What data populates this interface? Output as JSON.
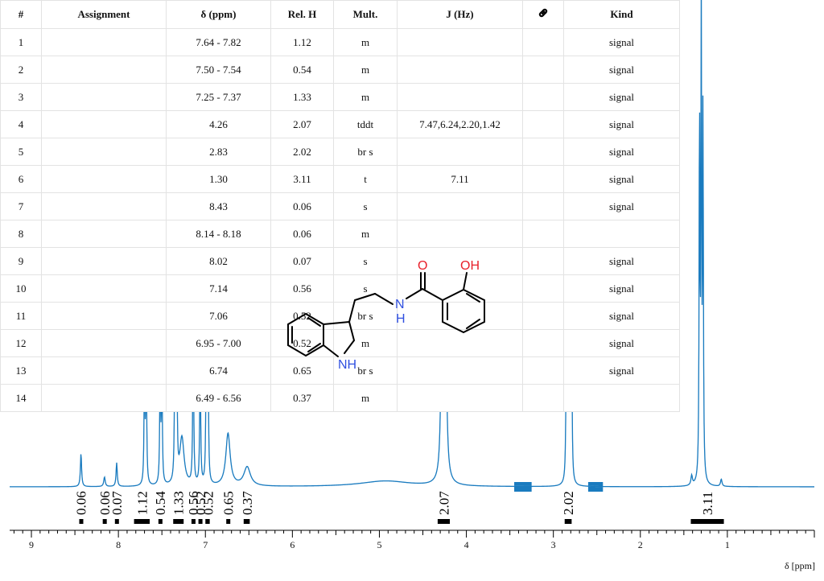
{
  "table": {
    "columns": [
      "#",
      "Assignment",
      "δ (ppm)",
      "Rel. H",
      "Mult.",
      "J (Hz)",
      "link-icon",
      "Kind"
    ],
    "rows": [
      [
        "1",
        "",
        "7.64 - 7.82",
        "1.12",
        "m",
        "",
        "",
        "signal"
      ],
      [
        "2",
        "",
        "7.50 - 7.54",
        "0.54",
        "m",
        "",
        "",
        "signal"
      ],
      [
        "3",
        "",
        "7.25 - 7.37",
        "1.33",
        "m",
        "",
        "",
        "signal"
      ],
      [
        "4",
        "",
        "4.26",
        "2.07",
        "tddt",
        "7.47,6.24,2.20,1.42",
        "",
        "signal"
      ],
      [
        "5",
        "",
        "2.83",
        "2.02",
        "br s",
        "",
        "",
        "signal"
      ],
      [
        "6",
        "",
        "1.30",
        "3.11",
        "t",
        "7.11",
        "",
        "signal"
      ],
      [
        "7",
        "",
        "8.43",
        "0.06",
        "s",
        "",
        "",
        "signal"
      ],
      [
        "8",
        "",
        "8.14 - 8.18",
        "0.06",
        "m",
        "",
        "",
        ""
      ],
      [
        "9",
        "",
        "8.02",
        "0.07",
        "s",
        "",
        "",
        "signal"
      ],
      [
        "10",
        "",
        "7.14",
        "0.56",
        "s",
        "",
        "",
        "signal"
      ],
      [
        "11",
        "",
        "7.06",
        "0.52",
        "br s",
        "",
        "",
        "signal"
      ],
      [
        "12",
        "",
        "6.95 - 7.00",
        "0.52",
        "m",
        "",
        "",
        "signal"
      ],
      [
        "13",
        "",
        "6.74",
        "0.65",
        "br s",
        "",
        "",
        "signal"
      ],
      [
        "14",
        "",
        "6.49 - 6.56",
        "0.37",
        "m",
        "",
        "",
        ""
      ]
    ]
  },
  "molecule": {
    "labels": {
      "o1": "O",
      "oh": "OH",
      "n": "N",
      "h": "H",
      "nh": "NH"
    },
    "colors": {
      "oxygen": "#e8202a",
      "nitrogen": "#3050e0",
      "bond": "#000000"
    }
  },
  "chart_data": {
    "type": "line",
    "xlabel": "δ [ppm]",
    "xlim": [
      9.25,
      0.0
    ],
    "x_ticks": [
      9,
      8,
      7,
      6,
      5,
      4,
      3,
      2,
      1
    ],
    "line_color": "#1a7bbf",
    "peaks": [
      {
        "x": 8.43,
        "h": 0.07,
        "w": 0.008
      },
      {
        "x": 8.16,
        "h": 0.02,
        "w": 0.01
      },
      {
        "x": 8.02,
        "h": 0.05,
        "w": 0.008
      },
      {
        "x": 7.7,
        "h": 0.25,
        "w": 0.006
      },
      {
        "x": 7.68,
        "h": 0.27,
        "w": 0.006
      },
      {
        "x": 7.52,
        "h": 0.25,
        "w": 0.006
      },
      {
        "x": 7.5,
        "h": 0.24,
        "w": 0.006
      },
      {
        "x": 7.35,
        "h": 0.34,
        "w": 0.006
      },
      {
        "x": 7.33,
        "h": 0.32,
        "w": 0.006
      },
      {
        "x": 7.27,
        "h": 0.1,
        "w": 0.03
      },
      {
        "x": 7.14,
        "h": 0.36,
        "w": 0.006
      },
      {
        "x": 7.06,
        "h": 0.29,
        "w": 0.006
      },
      {
        "x": 6.99,
        "h": 0.3,
        "w": 0.006
      },
      {
        "x": 6.97,
        "h": 0.32,
        "w": 0.006
      },
      {
        "x": 6.74,
        "h": 0.11,
        "w": 0.03
      },
      {
        "x": 6.52,
        "h": 0.04,
        "w": 0.045
      },
      {
        "x": 4.93,
        "h": 0.012,
        "w": 0.35
      },
      {
        "x": 4.28,
        "h": 0.4,
        "w": 0.012
      },
      {
        "x": 4.26,
        "h": 0.42,
        "w": 0.012
      },
      {
        "x": 4.24,
        "h": 0.4,
        "w": 0.012
      },
      {
        "x": 2.85,
        "h": 0.35,
        "w": 0.006
      },
      {
        "x": 2.83,
        "h": 0.34,
        "w": 0.006
      },
      {
        "x": 2.81,
        "h": 0.33,
        "w": 0.006
      },
      {
        "x": 2.79,
        "h": 0.32,
        "w": 0.006
      },
      {
        "x": 1.32,
        "h": 0.8,
        "w": 0.005
      },
      {
        "x": 1.3,
        "h": 1.0,
        "w": 0.005
      },
      {
        "x": 1.28,
        "h": 0.78,
        "w": 0.005
      },
      {
        "x": 1.41,
        "h": 0.02,
        "w": 0.01
      },
      {
        "x": 1.07,
        "h": 0.015,
        "w": 0.01
      }
    ],
    "integrals": [
      {
        "label": "0.06",
        "x": 8.43,
        "from": 8.45,
        "to": 8.41
      },
      {
        "label": "0.06",
        "x": 8.16,
        "from": 8.18,
        "to": 8.14
      },
      {
        "label": "0.07",
        "x": 8.02,
        "from": 8.04,
        "to": 8.0
      },
      {
        "label": "1.12",
        "x": 7.73,
        "from": 7.82,
        "to": 7.64
      },
      {
        "label": "0.54",
        "x": 7.52,
        "from": 7.54,
        "to": 7.5
      },
      {
        "label": "1.33",
        "x": 7.31,
        "from": 7.37,
        "to": 7.25
      },
      {
        "label": "0.56",
        "x": 7.14,
        "from": 7.16,
        "to": 7.12
      },
      {
        "label": "0.52",
        "x": 7.06,
        "from": 7.08,
        "to": 7.04
      },
      {
        "label": "0.52",
        "x": 6.97,
        "from": 7.0,
        "to": 6.95
      },
      {
        "label": "0.65",
        "x": 6.74,
        "from": 6.76,
        "to": 6.72
      },
      {
        "label": "0.37",
        "x": 6.52,
        "from": 6.56,
        "to": 6.49
      },
      {
        "label": "2.07",
        "x": 4.26,
        "from": 4.33,
        "to": 4.19
      },
      {
        "label": "2.02",
        "x": 2.83,
        "from": 2.87,
        "to": 2.79
      },
      {
        "label": "3.11",
        "x": 1.23,
        "from": 1.42,
        "to": 1.04
      }
    ],
    "excluded_regions": [
      {
        "from": 3.45,
        "to": 3.25
      },
      {
        "from": 2.6,
        "to": 2.43
      }
    ]
  }
}
